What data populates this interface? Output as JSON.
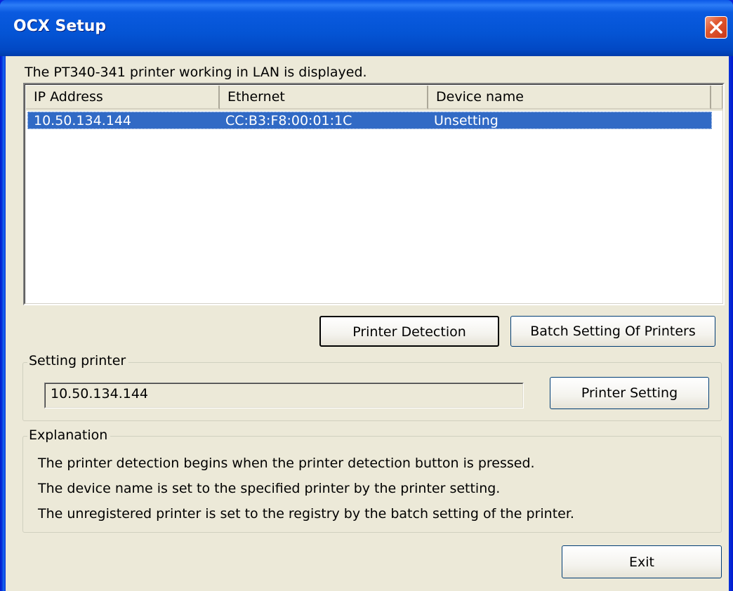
{
  "window": {
    "title": "OCX Setup"
  },
  "list": {
    "caption": "The PT340-341 printer working in LAN is displayed.",
    "columns": [
      "IP Address",
      "Ethernet",
      "Device name"
    ],
    "rows": [
      {
        "ip": "10.50.134.144",
        "ethernet": "CC:B3:F8:00:01:1C",
        "device_name": "Unsetting",
        "selected": true
      }
    ]
  },
  "buttons": {
    "printer_detection": "Printer Detection",
    "batch_setting": "Batch Setting Of Printers",
    "printer_setting": "Printer Setting",
    "exit": "Exit"
  },
  "setting_printer": {
    "legend": "Setting printer",
    "value": "10.50.134.144"
  },
  "explanation": {
    "legend": "Explanation",
    "lines": [
      "The printer detection begins when the printer detection button is pressed.",
      "The device name is set to the specified printer by the printer setting.",
      "The unregistered printer is set to the registry by the batch setting of the printer."
    ]
  },
  "colors": {
    "titlebar": "#0454d4",
    "selection": "#316ac5",
    "dialog_bg": "#ece9d8",
    "close_button": "#e0582f"
  },
  "icons": {
    "close": "close-icon"
  }
}
